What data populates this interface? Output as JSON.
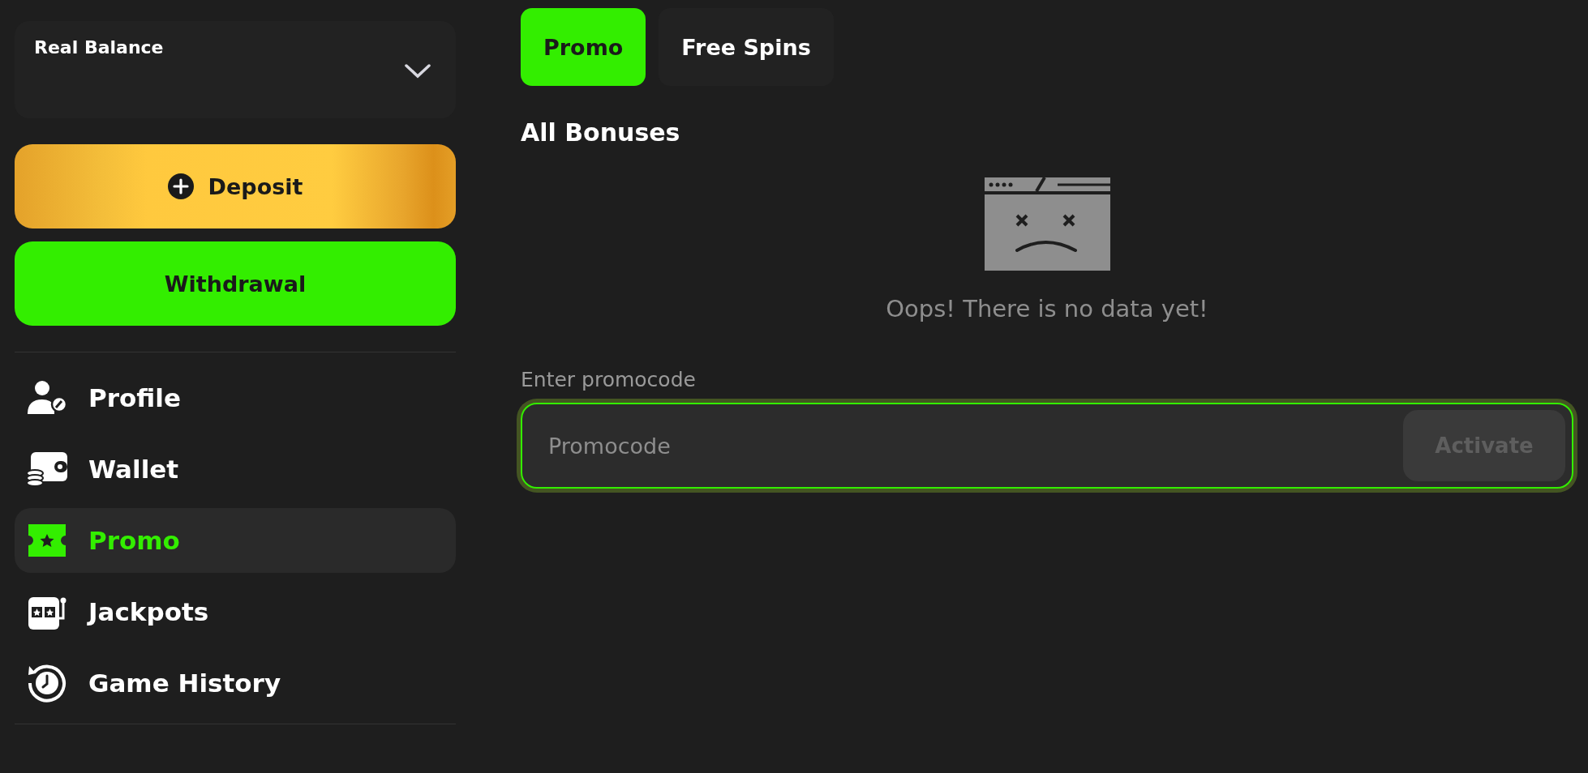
{
  "balance": {
    "label": "Real Balance"
  },
  "actions": [
    {
      "kind": "deposit",
      "label": "Deposit"
    },
    {
      "kind": "withdraw",
      "label": "Withdrawal"
    }
  ],
  "sidebar": {
    "items": [
      {
        "kind": "profile",
        "label": "Profile",
        "selected": false
      },
      {
        "kind": "wallet",
        "label": "Wallet",
        "selected": false
      },
      {
        "kind": "promo",
        "label": "Promo",
        "selected": true
      },
      {
        "kind": "jackpots",
        "label": "Jackpots",
        "selected": false
      },
      {
        "kind": "history",
        "label": "Game History",
        "selected": false
      }
    ]
  },
  "tabs": [
    {
      "label": "Promo",
      "selected": true
    },
    {
      "label": "Free Spins",
      "selected": false
    }
  ],
  "heading": "All Bonuses",
  "empty_message": "Oops! There is no data yet!",
  "promocode": {
    "label": "Enter promocode",
    "placeholder": "Promocode",
    "focused": true,
    "button": {
      "label": "Activate",
      "disabled": true
    }
  }
}
